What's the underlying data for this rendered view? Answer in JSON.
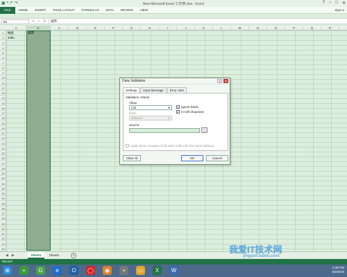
{
  "window": {
    "title": "New Microsoft Excel 工作表.xlsx - Excel",
    "signin": "Sign in"
  },
  "ribbon": {
    "tabs": [
      "FILE",
      "HOME",
      "INSERT",
      "PAGE LAYOUT",
      "FORMULAS",
      "DATA",
      "REVIEW",
      "VIEW"
    ]
  },
  "formula_bar": {
    "name_box": "B1",
    "content": "城市"
  },
  "grid": {
    "columns": [
      "A",
      "B",
      "C",
      "D",
      "E",
      "F",
      "G",
      "H",
      "I",
      "J",
      "K",
      "L",
      "M",
      "N",
      "O",
      "P",
      "Q",
      "R"
    ],
    "rows": [
      "1",
      "2",
      "3",
      "4",
      "5",
      "6",
      "7",
      "8",
      "9",
      "10",
      "11",
      "12",
      "13",
      "14",
      "15",
      "16",
      "17",
      "18",
      "19",
      "20",
      "21",
      "22",
      "23",
      "24",
      "25",
      "26",
      "27",
      "28",
      "29",
      "30",
      "31",
      "32",
      "33",
      "34",
      "35",
      "36",
      "37",
      "38",
      "39",
      "40",
      "41",
      "42",
      "43",
      "44"
    ],
    "cells": {
      "A1": "姓名",
      "B1": "城市",
      "A2": "John"
    },
    "selected_column": "B"
  },
  "dialog": {
    "title": "Data Validation",
    "tabs": [
      "Settings",
      "Input Message",
      "Error Alert"
    ],
    "active_tab": "Settings",
    "section_label": "Validation criteria",
    "allow_label": "Allow:",
    "allow_value": "List",
    "data_label": "Data:",
    "data_value": "between",
    "ignore_blank_label": "Ignore blank",
    "ignore_blank_checked": true,
    "incell_dropdown_label": "In-cell dropdown",
    "incell_dropdown_checked": true,
    "source_label": "Source:",
    "source_value": "",
    "apply_all_label": "Apply these changes to all other cells with the same settings",
    "clear_all_label": "Clear All",
    "ok_label": "OK",
    "cancel_label": "Cancel"
  },
  "sheets": {
    "tabs": [
      "Sheet1",
      "Sheet2"
    ],
    "active": "Sheet1"
  },
  "status": {
    "ready": "READY"
  },
  "taskbar": {
    "time": "6:38 PM",
    "date": "9/2/2015"
  },
  "watermark": {
    "main": "我爱IT技术网",
    "sub": "jingyan.baidu.com"
  },
  "colors": {
    "excel_green": "#217346",
    "sheet_bg": "#dceedd",
    "selected_col": "#8fac90",
    "taskbar": "#4d6a8c"
  }
}
